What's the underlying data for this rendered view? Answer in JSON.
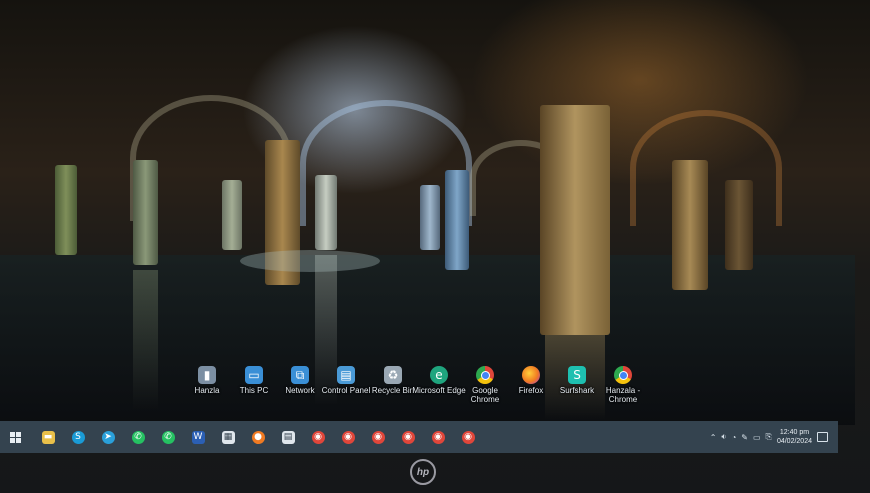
{
  "wallpaper": {
    "description_colors": {
      "stone": "#a88a55",
      "light": "#c8e0ff",
      "water": "#1a2c33"
    }
  },
  "desktop_icons": [
    {
      "label": "Hanzla",
      "icon": "folder-user-icon",
      "color": "#7c8fa3"
    },
    {
      "label": "This PC",
      "icon": "computer-icon",
      "color": "#3a8fd6"
    },
    {
      "label": "Network",
      "icon": "network-icon",
      "color": "#3a8fd6"
    },
    {
      "label": "Control Panel",
      "icon": "control-panel-icon",
      "color": "#4a9ad6"
    },
    {
      "label": "Recycle Bin",
      "icon": "recycle-bin-icon",
      "color": "#9aa8b4"
    },
    {
      "label": "Microsoft Edge",
      "icon": "edge-icon",
      "color": "#1fa57e"
    },
    {
      "label": "Google Chrome",
      "icon": "chrome-icon",
      "color": "#e0463a"
    },
    {
      "label": "Firefox",
      "icon": "firefox-icon",
      "color": "#f07a22"
    },
    {
      "label": "Surfshark",
      "icon": "surfshark-icon",
      "color": "#1ec0b0"
    },
    {
      "label": "Hanzala - Chrome",
      "icon": "chrome-profile-icon",
      "color": "#e0463a"
    }
  ],
  "taskbar": {
    "start_icon": "windows-start-icon",
    "apps": [
      {
        "name": "file-explorer-icon",
        "color": "#e9c04a",
        "glyph": "▬"
      },
      {
        "name": "skype-icon",
        "color": "#1a9bd6",
        "glyph": "S"
      },
      {
        "name": "telegram-icon",
        "color": "#2aa0da",
        "glyph": "➤"
      },
      {
        "name": "whatsapp-icon",
        "color": "#25c262",
        "glyph": "✆"
      },
      {
        "name": "whatsapp-icon",
        "color": "#25c262",
        "glyph": "✆"
      },
      {
        "name": "word-icon",
        "color": "#2b5fb4",
        "glyph": "W"
      },
      {
        "name": "store-icon",
        "color": "#dfe6ec",
        "glyph": "▦"
      },
      {
        "name": "firefox-icon",
        "color": "#f07a22",
        "glyph": "●"
      },
      {
        "name": "store-bag-icon",
        "color": "#dfe6ec",
        "glyph": "▤"
      },
      {
        "name": "chrome-icon",
        "color": "#e0463a",
        "glyph": "◉"
      },
      {
        "name": "chrome-icon",
        "color": "#e0463a",
        "glyph": "◉"
      },
      {
        "name": "chrome-icon",
        "color": "#e0463a",
        "glyph": "◉"
      },
      {
        "name": "chrome-icon",
        "color": "#e0463a",
        "glyph": "◉"
      },
      {
        "name": "chrome-icon",
        "color": "#e0463a",
        "glyph": "◉"
      },
      {
        "name": "chrome-icon",
        "color": "#e0463a",
        "glyph": "◉"
      }
    ],
    "tray": {
      "clock_time": "12:40 pm",
      "clock_date": "04/02/2024"
    }
  },
  "monitor": {
    "logo_text": "hp"
  }
}
